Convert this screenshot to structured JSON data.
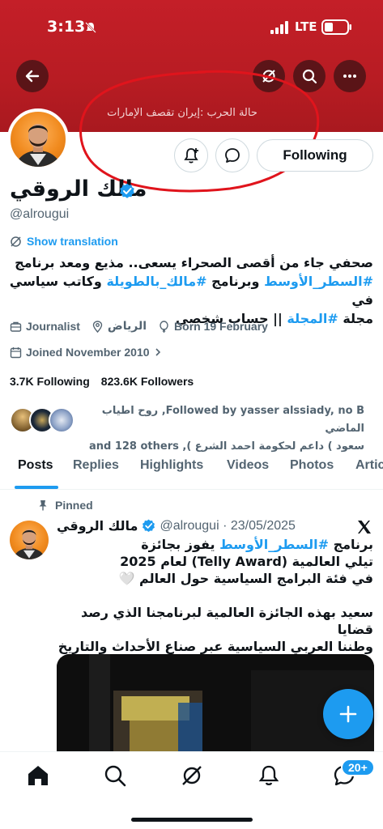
{
  "status_bar": {
    "time": "3:13",
    "network": "LTE"
  },
  "banner": {
    "text": "حالة الحرب :إيران تقصف الإمارات"
  },
  "profile": {
    "name": "مالك الروقي",
    "handle": "@alrougui",
    "following_label": "Following",
    "show_translation": "Show translation",
    "bio": {
      "line1": "صحفي جاء من أقصى الصحراء يسعى.. مذيع ومعد برنامج",
      "tag1": "#السطر_الأوسط",
      "mid1": " وبرنامج ",
      "tag2": "#مالك_بالطويلة",
      "mid2": " وكاتب سياسي في",
      "line3a": "مجلة ",
      "tag3": "#المجلة",
      "line3b": " || حساب شخصي"
    },
    "profession": "Journalist",
    "location": "الرياض",
    "born": "Born 19 February",
    "joined": "Joined November 2010",
    "following_count": "3.7K",
    "following_text": "Following",
    "followers_count": "823.6K",
    "followers_text": "Followers",
    "followed_by_line1": "Followed by yasser alssiady, no B, روح اطياب الماضي",
    "followed_by_line2": "سعود ) داعم لحكومة احمد الشرع ), and 128 others"
  },
  "tabs": [
    "Posts",
    "Replies",
    "Highlights",
    "Videos",
    "Photos",
    "Artic"
  ],
  "post": {
    "pinned_label": "Pinned",
    "author": "مالك الروقي",
    "handle_date": "@alrougui · 23/05/2025",
    "p1_a": "برنامج ",
    "p1_tag": "#السطر_الأوسط",
    "p1_b": " يفوز بجائزة",
    "p1_line2": "تيلي العالمية (Telly Award) لعام 2025",
    "p1_line3": "في فئة البرامج السياسية حول العالم 🤍",
    "p2_line1": "سعيد بهذه الجائزة العالمية لبرنامجنا الذي رصد قضايا",
    "p2_line2": "وطننا العربي السياسية عبر صناع الأحداث والتاريخ ."
  },
  "nav": {
    "badge": "20+"
  },
  "colors": {
    "accent": "#1d9bf0",
    "banner": "#b81c23",
    "annotation": "#e0141c"
  },
  "icons": [
    "back-icon",
    "grok-icon",
    "search-icon",
    "more-icon",
    "bell-plus-icon",
    "message-icon",
    "verified-icon",
    "translate-icon",
    "briefcase-icon",
    "location-icon",
    "balloon-icon",
    "calendar-icon",
    "pin-icon",
    "x-logo-icon",
    "plus-icon",
    "home-icon",
    "explore-icon",
    "notifications-icon",
    "messages-icon"
  ]
}
